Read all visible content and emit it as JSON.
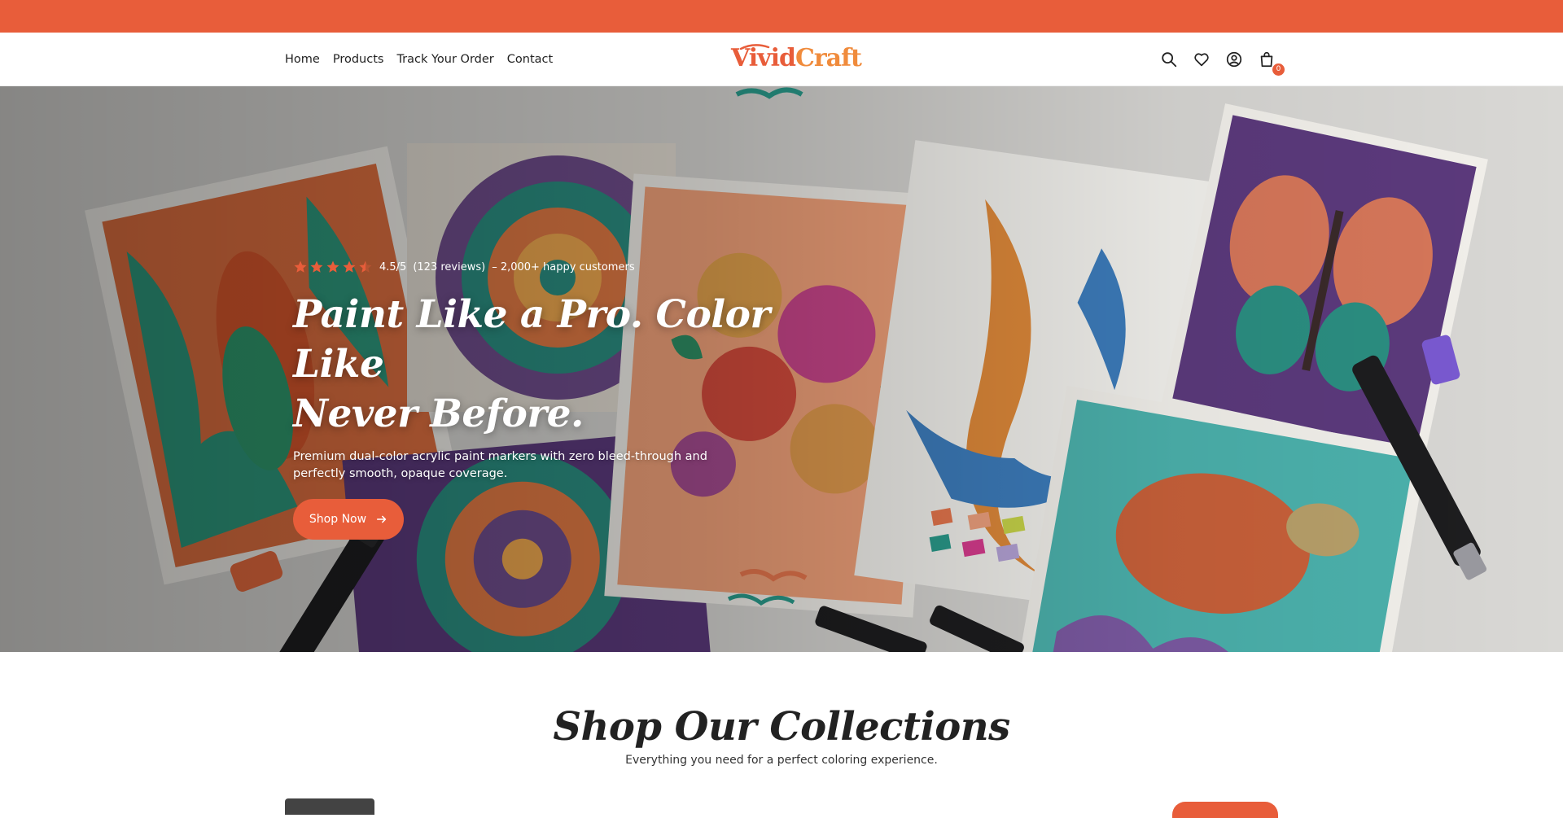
{
  "colors": {
    "accent": "#e85d3a",
    "accent_light": "#f08b3c",
    "text": "#222222",
    "star": "#e85d3a"
  },
  "header": {
    "nav": [
      {
        "label": "Home"
      },
      {
        "label": "Products"
      },
      {
        "label": "Track Your Order"
      },
      {
        "label": "Contact"
      }
    ],
    "logo": {
      "part1": "Vivid",
      "part2": "Craft"
    },
    "icons": [
      "search-icon",
      "heart-icon",
      "account-icon",
      "cart-icon"
    ],
    "cart_count": "0"
  },
  "hero": {
    "rating": {
      "stars": 4.5,
      "score": "4.5/5",
      "reviews": "(123 reviews)",
      "customers": "– 2,000+ happy customers"
    },
    "title_line1": "Paint Like a Pro. Color Like",
    "title_line2": "Never Before.",
    "subtitle": "Premium dual-color acrylic paint markers with zero bleed-through and perfectly smooth, opaque coverage.",
    "cta_label": "Shop Now"
  },
  "collections": {
    "title": "Shop Our Collections",
    "subtitle": "Everything you need for a perfect coloring experience."
  }
}
